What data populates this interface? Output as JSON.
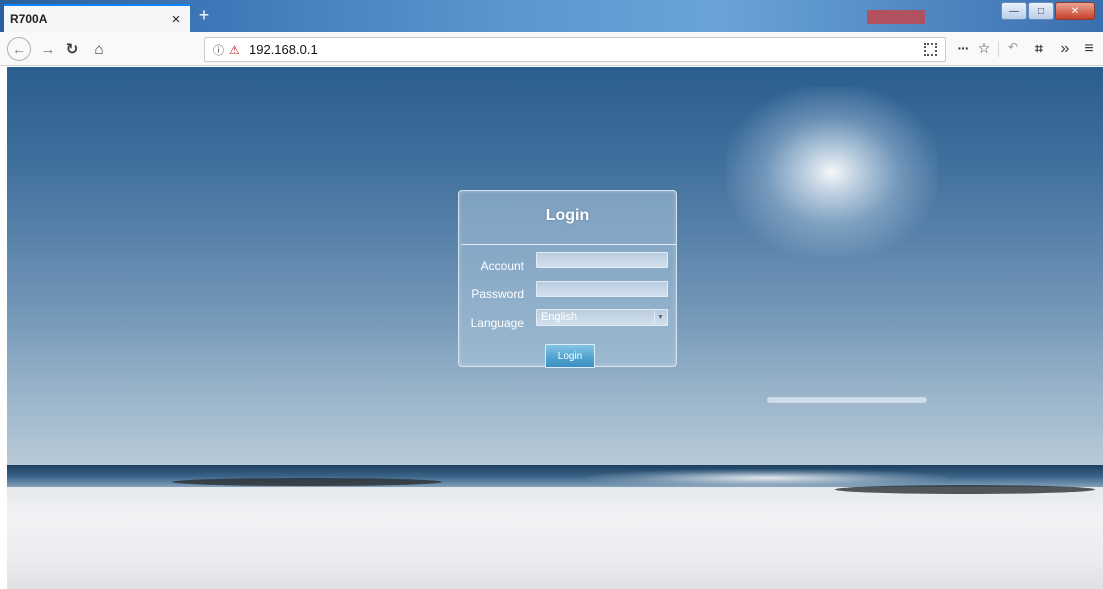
{
  "browser": {
    "tab_title": "R700A",
    "tab_close": "×",
    "new_tab": "+",
    "url": "192.168.0.1",
    "icons": {
      "back": "back-arrow-icon",
      "forward": "forward-arrow-icon",
      "reload": "reload-icon",
      "home": "home-icon",
      "info": "info-icon",
      "insecure": "insecure-connection-icon",
      "qr": "qr-code-icon",
      "more": "more-icon",
      "bookmark": "star-icon",
      "undo": "undo-icon",
      "screenshot": "crop-icon",
      "overflow": "chevron-overflow-icon",
      "menu": "hamburger-menu-icon"
    },
    "window_controls": [
      "minimize",
      "maximize",
      "close"
    ]
  },
  "login": {
    "title": "Login",
    "account_label": "Account",
    "account_value": "",
    "password_label": "Password",
    "password_value": "",
    "language_label": "Language",
    "language_selected": "English",
    "submit_label": "Login"
  },
  "colors": {
    "tab_accent": "#0a84ff",
    "login_button": "#4ea2cf",
    "panel": "#aac4db"
  }
}
